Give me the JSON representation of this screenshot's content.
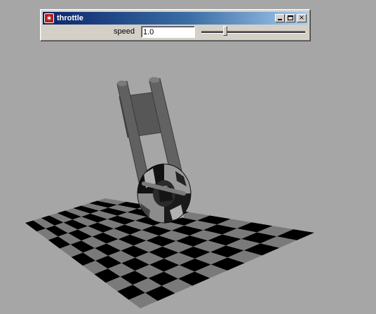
{
  "window": {
    "title": "throttle",
    "icon": "app-logo-icon",
    "buttons": [
      "minimize-icon",
      "maximize-icon",
      "close-icon"
    ],
    "close_glyph": "×"
  },
  "controls": {
    "speed_label": "speed",
    "speed_value": "1.0",
    "slider_fraction": 0.22
  },
  "colors": {
    "background": "#a6a6a6",
    "titlebar_start": "#0a246a",
    "titlebar_end": "#a6caf0",
    "checker_dark": "#000000",
    "checker_light": "#7a7a7a",
    "fork": "#5b5b5b"
  }
}
